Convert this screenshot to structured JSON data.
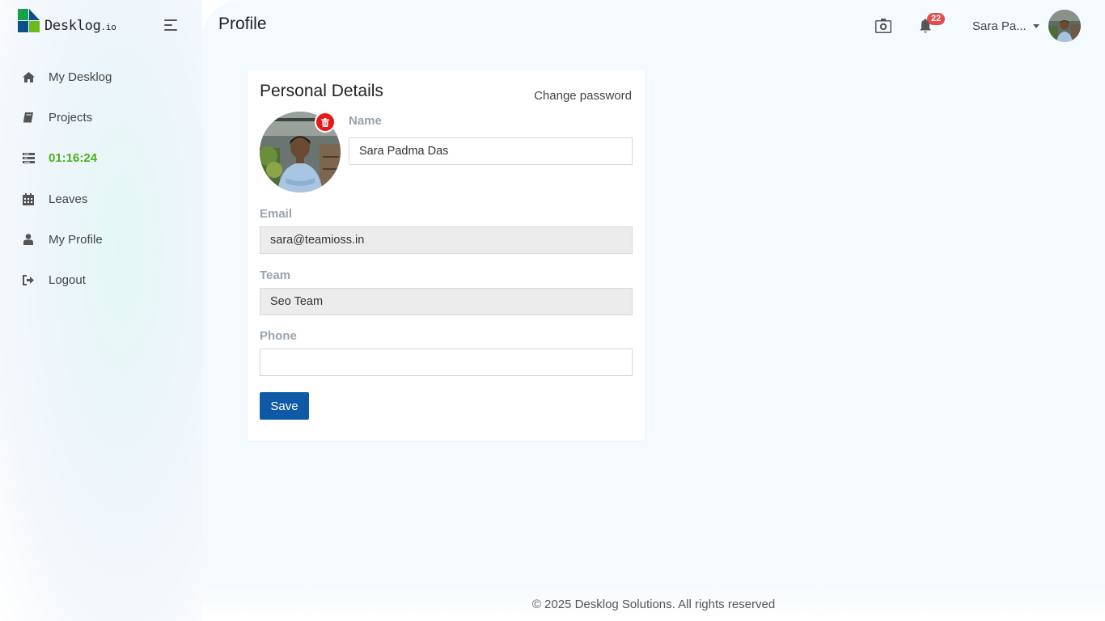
{
  "app": {
    "logo_text": "Desklog",
    "logo_suffix": ".io",
    "page_title": "Profile"
  },
  "sidebar": {
    "items": [
      {
        "label": "My Desklog",
        "icon": "home-icon"
      },
      {
        "label": "Projects",
        "icon": "book-icon"
      },
      {
        "label": "01:16:24",
        "icon": "timer-list-icon"
      },
      {
        "label": "Leaves",
        "icon": "calendar-icon"
      },
      {
        "label": "My Profile",
        "icon": "user-icon"
      },
      {
        "label": "Logout",
        "icon": "logout-icon"
      }
    ]
  },
  "topbar": {
    "notification_count": "22",
    "user_name": "Sara Pa..."
  },
  "profile": {
    "card_title": "Personal Details",
    "change_password_label": "Change password",
    "name_label": "Name",
    "name_value": "Sara Padma Das",
    "email_label": "Email",
    "email_value": "sara@teamioss.in",
    "team_label": "Team",
    "team_value": "Seo Team",
    "phone_label": "Phone",
    "phone_value": "",
    "save_label": "Save"
  },
  "footer": {
    "text": "© 2025 Desklog Solutions. All rights reserved"
  },
  "colors": {
    "primary": "#0e5aa7",
    "timer_green": "#4caf1a",
    "badge_red": "#e64b4b",
    "delete_red": "#e81919"
  }
}
